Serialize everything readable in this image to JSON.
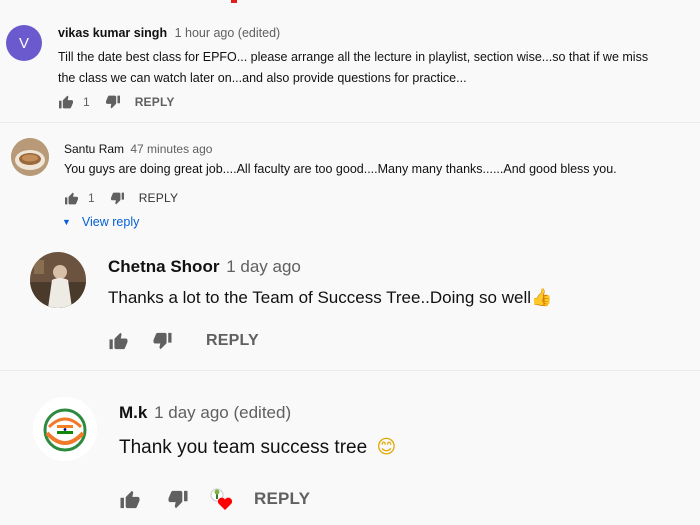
{
  "comments": [
    {
      "author": "vikas kumar singh",
      "time": "1 hour ago (edited)",
      "avatar_letter": "V",
      "avatar_color": "#6a5acd",
      "text_line1": "Till the date best class for EPFO... please arrange all the lecture in playlist, section wise...so that if we miss",
      "text_line2": "the class we can watch later on...and also provide questions for practice...",
      "likes": "1",
      "reply_label": "REPLY"
    },
    {
      "author": "Santu Ram",
      "time": "47 minutes ago",
      "text": "You guys are doing great job....All faculty are too good....Many many thanks......And good bless you.",
      "likes": "1",
      "reply_label": "REPLY",
      "view_reply": "View reply"
    },
    {
      "author": "Chetna Shoor",
      "time": "1 day ago",
      "text": "Thanks a lot to the Team of Success Tree..Doing so well",
      "emoji": "👍",
      "reply_label": "REPLY"
    },
    {
      "author": "M.k",
      "time": "1 day ago (edited)",
      "text": "Thank you team success tree",
      "emoji": "😊",
      "reply_label": "REPLY"
    }
  ],
  "colors": {
    "link_blue": "#065fd4",
    "heart_red": "#ff0000",
    "icon_gray": "#606060"
  }
}
